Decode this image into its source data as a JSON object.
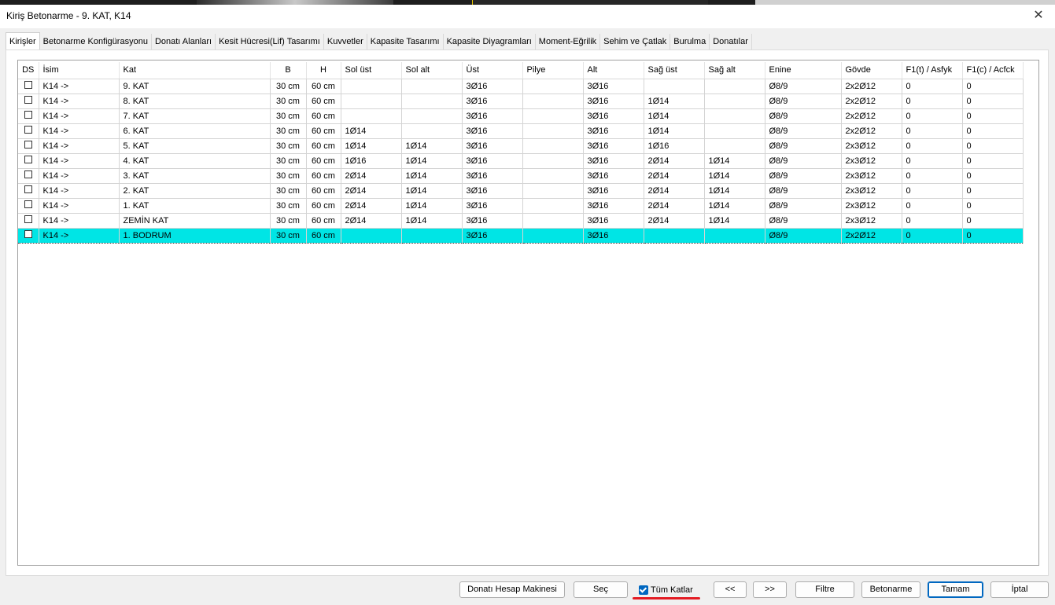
{
  "window": {
    "title": "Kiriş Betonarme - 9. KAT, K14",
    "close": "✕"
  },
  "tabs": [
    "Kirişler",
    "Betonarme Konfigürasyonu",
    "Donatı Alanları",
    "Kesit Hücresi(Lif) Tasarımı",
    "Kuvvetler",
    "Kapasite Tasarımı",
    "Kapasite Diyagramları",
    "Moment-Eğrilik",
    "Sehim ve Çatlak",
    "Burulma",
    "Donatılar"
  ],
  "table": {
    "headers": [
      "DS",
      "İsim",
      "Kat",
      "B",
      "H",
      "Sol üst",
      "Sol alt",
      "Üst",
      "Pilye",
      "Alt",
      "Sağ üst",
      "Sağ alt",
      "Enine",
      "Gövde",
      "F1(t) / Asfyk",
      "F1(c) / Acfck"
    ],
    "rows": [
      [
        "",
        "K14 ->",
        "9. KAT",
        "30 cm",
        "60 cm",
        "",
        "",
        "3Ø16",
        "",
        "3Ø16",
        "",
        "",
        "Ø8/9",
        "2x2Ø12",
        "0",
        "0"
      ],
      [
        "",
        "K14 ->",
        "8. KAT",
        "30 cm",
        "60 cm",
        "",
        "",
        "3Ø16",
        "",
        "3Ø16",
        "1Ø14",
        "",
        "Ø8/9",
        "2x2Ø12",
        "0",
        "0"
      ],
      [
        "",
        "K14 ->",
        "7. KAT",
        "30 cm",
        "60 cm",
        "",
        "",
        "3Ø16",
        "",
        "3Ø16",
        "1Ø14",
        "",
        "Ø8/9",
        "2x2Ø12",
        "0",
        "0"
      ],
      [
        "",
        "K14 ->",
        "6. KAT",
        "30 cm",
        "60 cm",
        "1Ø14",
        "",
        "3Ø16",
        "",
        "3Ø16",
        "1Ø14",
        "",
        "Ø8/9",
        "2x2Ø12",
        "0",
        "0"
      ],
      [
        "",
        "K14 ->",
        "5. KAT",
        "30 cm",
        "60 cm",
        "1Ø14",
        "1Ø14",
        "3Ø16",
        "",
        "3Ø16",
        "1Ø16",
        "",
        "Ø8/9",
        "2x3Ø12",
        "0",
        "0"
      ],
      [
        "",
        "K14 ->",
        "4. KAT",
        "30 cm",
        "60 cm",
        "1Ø16",
        "1Ø14",
        "3Ø16",
        "",
        "3Ø16",
        "2Ø14",
        "1Ø14",
        "Ø8/9",
        "2x3Ø12",
        "0",
        "0"
      ],
      [
        "",
        "K14 ->",
        "3. KAT",
        "30 cm",
        "60 cm",
        "2Ø14",
        "1Ø14",
        "3Ø16",
        "",
        "3Ø16",
        "2Ø14",
        "1Ø14",
        "Ø8/9",
        "2x3Ø12",
        "0",
        "0"
      ],
      [
        "",
        "K14 ->",
        "2. KAT",
        "30 cm",
        "60 cm",
        "2Ø14",
        "1Ø14",
        "3Ø16",
        "",
        "3Ø16",
        "2Ø14",
        "1Ø14",
        "Ø8/9",
        "2x3Ø12",
        "0",
        "0"
      ],
      [
        "",
        "K14 ->",
        "1. KAT",
        "30 cm",
        "60 cm",
        "2Ø14",
        "1Ø14",
        "3Ø16",
        "",
        "3Ø16",
        "2Ø14",
        "1Ø14",
        "Ø8/9",
        "2x3Ø12",
        "0",
        "0"
      ],
      [
        "",
        "K14 ->",
        "ZEMİN KAT",
        "30 cm",
        "60 cm",
        "2Ø14",
        "1Ø14",
        "3Ø16",
        "",
        "3Ø16",
        "2Ø14",
        "1Ø14",
        "Ø8/9",
        "2x3Ø12",
        "0",
        "0"
      ],
      [
        "",
        "K14 ->",
        "1. BODRUM",
        "30 cm",
        "60 cm",
        "",
        "",
        "3Ø16",
        "",
        "3Ø16",
        "",
        "",
        "Ø8/9",
        "2x2Ø12",
        "0",
        "0"
      ]
    ]
  },
  "buttons": {
    "calculator": "Donatı Hesap Makinesi",
    "select": "Seç",
    "all_floors": "Tüm Katlar",
    "prev": "<<",
    "next": ">>",
    "filter": "Filtre",
    "concrete": "Betonarme",
    "ok": "Tamam",
    "cancel": "İptal"
  },
  "colors": {
    "selected_row": "#00e5e5",
    "accent": "#0067c0",
    "underline": "#e31b23"
  }
}
